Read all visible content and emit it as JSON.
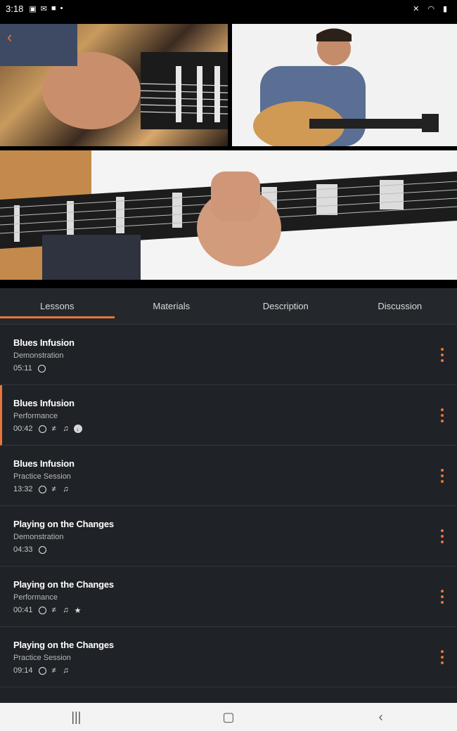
{
  "status": {
    "time": "3:18"
  },
  "tabs": [
    "Lessons",
    "Materials",
    "Description",
    "Discussion"
  ],
  "colors": {
    "accent": "#e8753c",
    "background": "#1f2226"
  },
  "lessons": [
    {
      "title": "Blues Infusion",
      "subtitle": "Demonstration",
      "duration": "05:11",
      "icons": [
        "circle-icon"
      ]
    },
    {
      "title": "Blues Infusion",
      "subtitle": "Performance",
      "duration": "00:42",
      "icons": [
        "circle-icon",
        "tab-icon",
        "music-note-icon",
        "download-icon"
      ],
      "active": true
    },
    {
      "title": "Blues Infusion",
      "subtitle": "Practice Session",
      "duration": "13:32",
      "icons": [
        "circle-icon",
        "tab-icon",
        "music-note-icon"
      ]
    },
    {
      "title": "Playing on the Changes",
      "subtitle": "Demonstration",
      "duration": "04:33",
      "icons": [
        "circle-icon"
      ]
    },
    {
      "title": "Playing on the Changes",
      "subtitle": "Performance",
      "duration": "00:41",
      "icons": [
        "circle-icon",
        "tab-icon",
        "music-note-icon",
        "star-icon"
      ]
    },
    {
      "title": "Playing on the Changes",
      "subtitle": "Practice Session",
      "duration": "09:14",
      "icons": [
        "circle-icon",
        "tab-icon",
        "music-note-icon"
      ]
    }
  ]
}
